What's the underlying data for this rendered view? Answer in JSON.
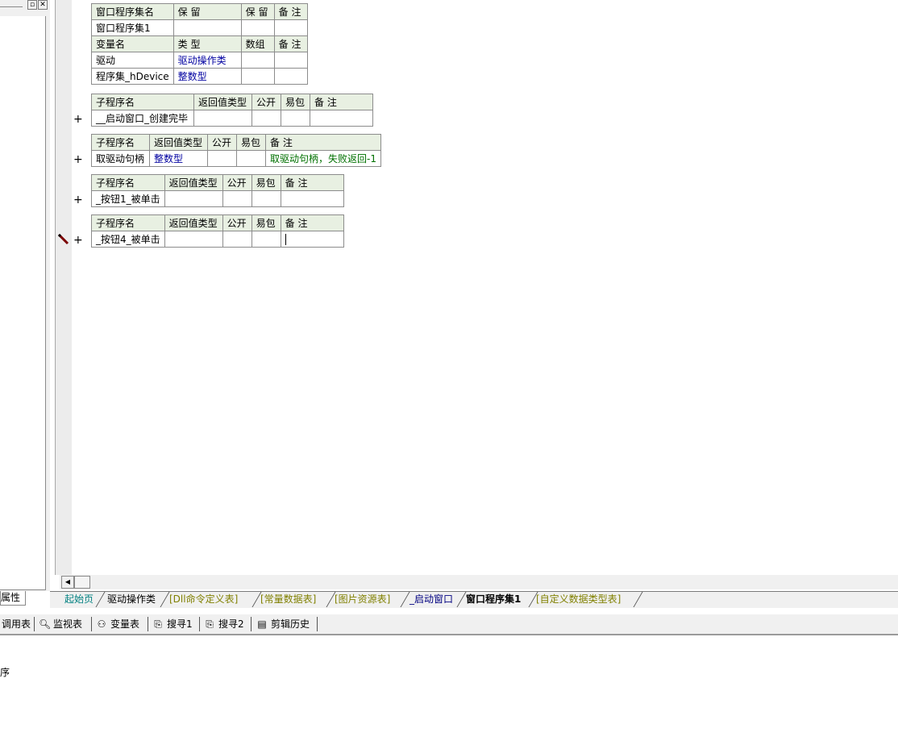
{
  "left_panel": {
    "tab_label": "属性"
  },
  "class_table": {
    "header1": [
      "窗口程序集名",
      "保 留",
      "保 留",
      "备 注"
    ],
    "row1": [
      "窗口程序集1",
      "",
      "",
      ""
    ],
    "header2": [
      "变量名",
      "类 型",
      "数组",
      "备 注"
    ],
    "vars": [
      {
        "name": "驱动",
        "type": "驱动操作类",
        "array": "",
        "note": ""
      },
      {
        "name": "程序集_hDevice",
        "type": "整数型",
        "array": "",
        "note": ""
      }
    ]
  },
  "subs": [
    {
      "headers": [
        "子程序名",
        "返回值类型",
        "公开",
        "易包",
        "备 注"
      ],
      "name": "__启动窗口_创建完毕",
      "ret": "",
      "public": "",
      "ebag": "",
      "note": ""
    },
    {
      "headers": [
        "子程序名",
        "返回值类型",
        "公开",
        "易包",
        "备 注"
      ],
      "name": "取驱动句柄",
      "ret": "整数型",
      "public": "",
      "ebag": "",
      "note": "取驱动句柄，失败返回-1"
    },
    {
      "headers": [
        "子程序名",
        "返回值类型",
        "公开",
        "易包",
        "备 注"
      ],
      "name": "_按钮1_被单击",
      "ret": "",
      "public": "",
      "ebag": "",
      "note": ""
    },
    {
      "headers": [
        "子程序名",
        "返回值类型",
        "公开",
        "易包",
        "备 注"
      ],
      "name": "_按钮4_被单击",
      "ret": "",
      "public": "",
      "ebag": "",
      "note": ""
    }
  ],
  "expand_symbol": "+",
  "tabs": [
    "起始页",
    "驱动操作类",
    "[Dll命令定义表]",
    "[常量数据表]",
    "[图片资源表]",
    "_启动窗口",
    "窗口程序集1",
    "[自定义数据类型表]"
  ],
  "bottom_tabs": [
    "调用表",
    "监视表",
    "变量表",
    "搜寻1",
    "搜寻2",
    "剪辑历史"
  ],
  "output_text": "序",
  "colors": {
    "header_bg": "#e8f0e2",
    "type_blue": "#0000a0",
    "note_green": "#007000",
    "tab_yellow": "#808000"
  }
}
